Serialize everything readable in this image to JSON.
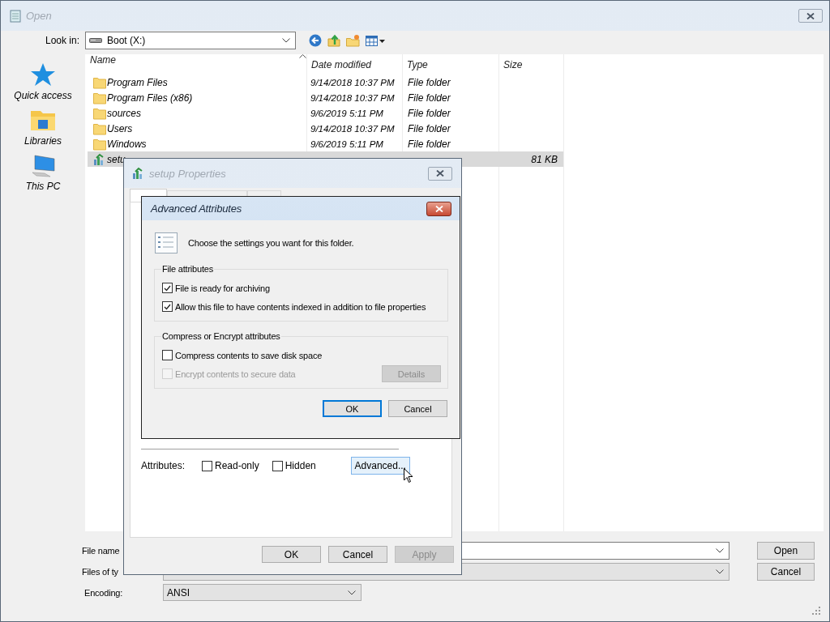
{
  "open_dialog": {
    "title": "Open",
    "active": false,
    "look_in_label": "Look in:",
    "look_in_value": "Boot (X:)",
    "places": [
      {
        "kind": "star",
        "label": "Quick access"
      },
      {
        "kind": "libraries",
        "label": "Libraries"
      },
      {
        "kind": "pc",
        "label": "This PC"
      }
    ],
    "file_list": {
      "columns": [
        "Name",
        "Date modified",
        "Type",
        "Size"
      ],
      "rows": [
        {
          "kind": "folder",
          "name": "Program Files",
          "date": "9/14/2018 10:37 PM",
          "type": "File folder",
          "selected": false
        },
        {
          "kind": "folder",
          "name": "Program Files (x86)",
          "date": "9/14/2018 10:37 PM",
          "type": "File folder",
          "selected": false
        },
        {
          "kind": "folder",
          "name": "sources",
          "date": "9/6/2019 5:11 PM",
          "type": "File folder",
          "selected": false
        },
        {
          "kind": "folder",
          "name": "Users",
          "date": "9/14/2018 10:37 PM",
          "type": "File folder",
          "selected": false
        },
        {
          "kind": "folder",
          "name": "Windows",
          "date": "9/6/2019 5:11 PM",
          "type": "File folder",
          "selected": false
        },
        {
          "kind": "app",
          "name": "setu",
          "size": "81 KB",
          "selected": true
        }
      ]
    },
    "file_name_label": "File name",
    "files_of_type_label": "Files of ty",
    "encoding_label": "Encoding:",
    "encoding_value": "ANSI",
    "buttons": [
      "Open",
      "Cancel"
    ]
  },
  "properties_dialog": {
    "title": "setup Properties",
    "active": false,
    "tabs": [
      {
        "selected": true
      },
      {
        "selected": false
      },
      {
        "selected": false
      }
    ],
    "attributes_label": "Attributes:",
    "attributes": [
      {
        "label": "Read-only",
        "checked": false
      },
      {
        "label": "Hidden",
        "checked": false
      }
    ],
    "advanced_button": "Advanced...",
    "buttons": [
      {
        "label": "OK",
        "disabled": false
      },
      {
        "label": "Cancel",
        "disabled": false
      },
      {
        "label": "Apply",
        "disabled": true
      }
    ]
  },
  "advanced_dialog": {
    "title": "Advanced Attributes",
    "active": true,
    "description": "Choose the settings you want for this folder.",
    "groups": [
      {
        "title": "File attributes",
        "options": [
          {
            "label": "File is ready for archiving",
            "checked": true,
            "disabled": false
          },
          {
            "label": "Allow this file to have contents indexed in addition to file properties",
            "checked": true,
            "disabled": false
          }
        ]
      },
      {
        "title": "Compress or Encrypt attributes",
        "options": [
          {
            "label": "Compress contents to save disk space",
            "checked": false,
            "disabled": false
          },
          {
            "label": "Encrypt contents to secure data",
            "checked": false,
            "disabled": true
          }
        ],
        "button": {
          "label": "Details",
          "disabled": true
        }
      }
    ],
    "buttons": [
      {
        "label": "OK",
        "focused": true
      },
      {
        "label": "Cancel",
        "focused": false
      }
    ]
  }
}
